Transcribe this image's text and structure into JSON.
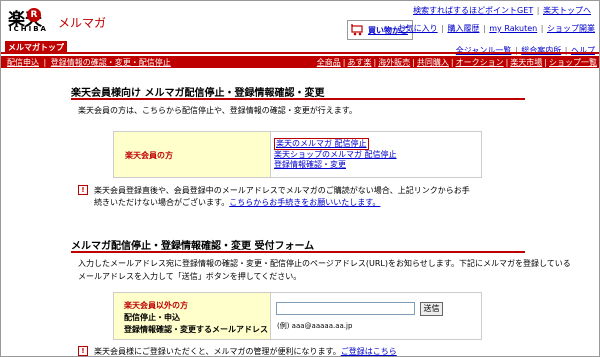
{
  "header": {
    "logo_kanji": "楽天",
    "logo_r": "R",
    "logo_sub": "ICHIBA",
    "service_title": "メルマガ",
    "cart_label": "買い物かご",
    "links_row1": [
      "検索すればするほどポイントGET",
      "楽天トップへ"
    ],
    "links_row2": [
      "お気に入り",
      "購入履歴",
      "my Rakuten",
      "ショップ開業"
    ],
    "links_row3": [
      "全ジャンル一覧",
      "総合案内所",
      "ヘルプ"
    ]
  },
  "tabbar": {
    "active_tab": "メルマガトップ"
  },
  "navbar": {
    "left": [
      "配信申込",
      "登録情報の確認・変更・配信停止"
    ],
    "right": [
      "全商品",
      "あす楽",
      "海外販売",
      "共同購入",
      "オークション",
      "楽天市場",
      "ショップ一覧"
    ]
  },
  "section1": {
    "title": "楽天会員様向け メルマガ配信停止・登録情報確認・変更",
    "intro": "楽天会員の方は、こちらから配信停止や、登録情報の確認・変更が行えます。",
    "box_label": "楽天会員の方",
    "links": [
      "楽天のメルマガ 配信停止",
      "楽天ショップのメルマガ 配信停止",
      "登録情報確認・変更"
    ],
    "notice_line1": "楽天会員登録直後や、会員登録中のメールアドレスでメルマガのご購読がない場合、上記リンクからお手",
    "notice_line2_text": "続きいただけない場合がございます。",
    "notice_line2_link": "こちらからお手続きをお願いいたします。",
    "notice_icon": "!"
  },
  "section2": {
    "title": "メルマガ配信停止・登録情報確認・変更 受付フォーム",
    "intro_line1": "入力したメールアドレス宛に登録情報の確認・変更・配信停止のページアドレス(URL)をお知らせします。下記にメルマガを登録している",
    "intro_line2": "メールアドレスを入力して「送信」ボタンを押してください。",
    "box_label_line1": "楽天会員以外の方",
    "box_label_line2": "配信停止・申込",
    "box_label_line3": "登録情報確認・変更するメールアドレス",
    "input_value": "",
    "send_label": "送信",
    "example": "(例) aaa@aaaaa.aa.jp",
    "notice_text": "楽天会員様にご登録いただくと、メルマガの管理が便利になります。",
    "notice_link": "ご登録はこちら",
    "notice_icon": "!"
  },
  "colors": {
    "brand": "#bf0000",
    "link": "#0000cc",
    "highlight": "#ffffcc"
  }
}
